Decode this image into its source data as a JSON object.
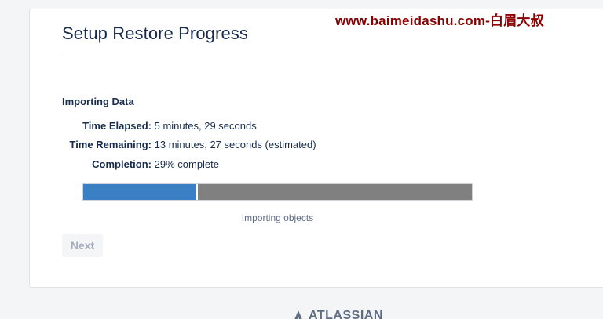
{
  "watermark": "www.baimeidashu.com-白眉大叔",
  "page": {
    "title": "Setup Restore Progress"
  },
  "import": {
    "heading": "Importing Data",
    "stats": [
      {
        "label": "Time Elapsed:",
        "value": "5 minutes, 29 seconds"
      },
      {
        "label": "Time Remaining:",
        "value": "13 minutes, 27 seconds (estimated)"
      },
      {
        "label": "Completion:",
        "value": "29% complete"
      }
    ],
    "progress": {
      "percent": 29,
      "caption": "Importing objects"
    }
  },
  "actions": {
    "next_label": "Next"
  },
  "footer": {
    "logo_text": "ATLASSIAN",
    "logo_icon": "atlassian-logo-icon"
  },
  "colors": {
    "progress_fill": "#3b7fc4",
    "progress_rest": "#808080",
    "watermark": "#8b0000"
  }
}
